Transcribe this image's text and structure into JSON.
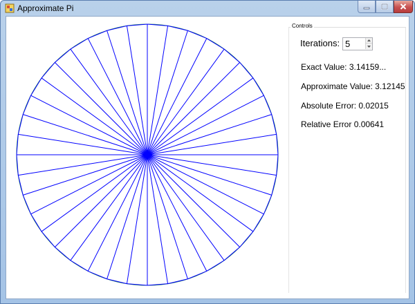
{
  "window": {
    "title": "Approximate Pi",
    "icon": "app-icon",
    "caption_buttons": [
      "minimize-icon",
      "maximize-icon",
      "close-icon"
    ]
  },
  "controls": {
    "group_label": "Controls",
    "iterations_label": "Iterations:",
    "iterations_value": "5",
    "exact_value": "Exact Value: 3.14159...",
    "approximate_value": "Approximate Value: 3.12145",
    "absolute_error": "Absolute Error: 0.02015",
    "relative_error": "Relative Error 0.00641"
  },
  "drawing": {
    "slice_count": 40,
    "circle_color": "#2e8b57",
    "polygon_color": "#0000ff"
  }
}
